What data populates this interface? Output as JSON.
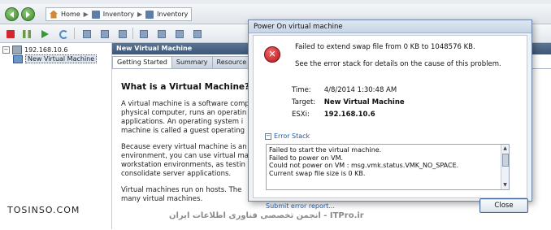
{
  "toolbar_nav": {
    "home_label": "Home",
    "inventory_label_1": "Inventory",
    "inventory_label_2": "Inventory",
    "separator": "▶"
  },
  "tree": {
    "host": "192.168.10.6",
    "vm": "New Virtual Machine"
  },
  "panel": {
    "title": "New Virtual Machine",
    "tabs": [
      "Getting Started",
      "Summary",
      "Resource Alloc"
    ],
    "heading": "What is a Virtual Machine?",
    "paragraphs": [
      [
        "A virtual machine is a software comp",
        "physical computer, runs an operatin",
        "applications. An operating system i",
        "machine is called a guest operating"
      ],
      [
        "Because every virtual machine is an",
        "environment, you can use virtual ma",
        "workstation environments, as testin",
        "consolidate server applications."
      ],
      [
        "Virtual machines run on hosts. The",
        "many virtual machines."
      ]
    ]
  },
  "dialog": {
    "title": "Power On virtual machine",
    "error_message": "Failed to extend swap file from 0 KB to 1048576 KB.",
    "error_hint": "See the error stack for details on the cause of this problem.",
    "details": [
      {
        "key": "Time:",
        "value": "4/8/2014 1:30:48 AM"
      },
      {
        "key": "Target:",
        "value": "New Virtual Machine"
      },
      {
        "key": "ESXi:",
        "value": "192.168.10.6"
      }
    ],
    "stack_label": "Error Stack",
    "stack_lines": [
      "Failed to start the virtual machine.",
      "Failed to power on VM.",
      "Could not power on VM : msg.vmk.status.VMK_NO_SPACE.",
      "Current swap file size is 0 KB."
    ],
    "submit_link": "Submit error report...",
    "close_label": "Close",
    "error_icon": "error-x-icon"
  },
  "watermarks": {
    "left": "TOSINSO.COM",
    "right": "ITPro.ir - انجمن تخصصی فناوری اطلاعات ایران"
  },
  "colors": {
    "panel_title_bg": "#3e5676",
    "error_red": "#b5121b",
    "link_blue": "#1e57a3"
  }
}
